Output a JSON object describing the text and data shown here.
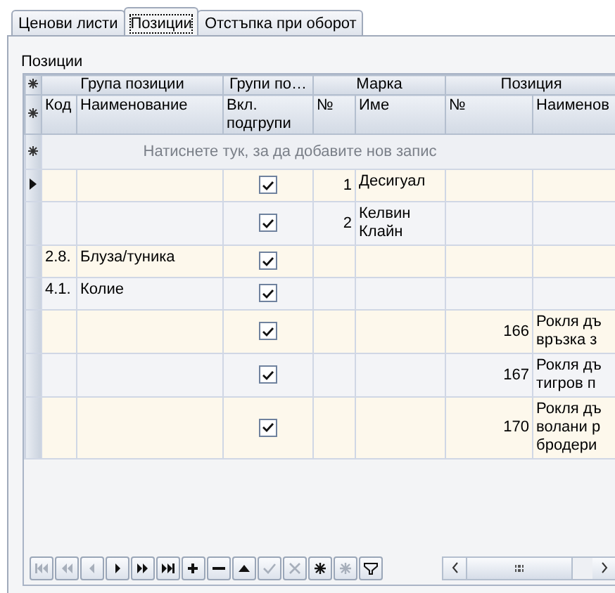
{
  "tabs": [
    {
      "label": "Ценови листи",
      "selected": false
    },
    {
      "label": "Позиции",
      "selected": true
    },
    {
      "label": "Отстъпка при оборот",
      "selected": false
    }
  ],
  "section_label": "Позиции",
  "grid": {
    "bands": [
      {
        "label": "Група позиции"
      },
      {
        "label": "Групи по…"
      },
      {
        "label": "Марка"
      },
      {
        "label": "Позиция"
      }
    ],
    "columns": [
      {
        "label": "Код",
        "kind": "text"
      },
      {
        "label": "Наименование",
        "kind": "text"
      },
      {
        "label": "Вкл. подгрупи",
        "kind": "check"
      },
      {
        "label": "№",
        "kind": "number"
      },
      {
        "label": "Име",
        "kind": "text"
      },
      {
        "label": "№",
        "kind": "number"
      },
      {
        "label": "Наименов",
        "kind": "text"
      }
    ],
    "new_row_prompt": "Натиснете тук, за да добавите нов запис",
    "rows": [
      {
        "selected": true,
        "include_subgroups": true,
        "brand_no": "1",
        "brand_name": "Десигуал"
      },
      {
        "selected": false,
        "include_subgroups": true,
        "brand_no": "2",
        "brand_name": "Келвин Клайн"
      },
      {
        "selected": false,
        "code": "2.8.",
        "name": "Блуза/туника",
        "include_subgroups": true
      },
      {
        "selected": false,
        "code": "4.1.",
        "name": "Колие",
        "include_subgroups": true
      },
      {
        "selected": false,
        "include_subgroups": true,
        "item_no": "166",
        "item_name": [
          "Рокля дъ",
          "връзка з"
        ]
      },
      {
        "selected": false,
        "include_subgroups": true,
        "item_no": "167",
        "item_name": [
          "Рокля дъ",
          "тигров п"
        ]
      },
      {
        "selected": false,
        "include_subgroups": true,
        "item_no": "170",
        "item_name": [
          "Рокля дъ",
          "волани р",
          "бродери"
        ]
      }
    ]
  },
  "navigator": {
    "buttons": [
      {
        "kind": "first",
        "disabled": true
      },
      {
        "kind": "prev-page",
        "disabled": true
      },
      {
        "kind": "prev",
        "disabled": true
      },
      {
        "kind": "next",
        "disabled": false
      },
      {
        "kind": "next-page",
        "disabled": false
      },
      {
        "kind": "last",
        "disabled": false
      },
      {
        "kind": "insert",
        "disabled": false
      },
      {
        "kind": "delete",
        "disabled": false
      },
      {
        "kind": "edit",
        "disabled": false
      },
      {
        "kind": "post",
        "disabled": true
      },
      {
        "kind": "cancel",
        "disabled": true
      },
      {
        "kind": "refresh",
        "disabled": false
      },
      {
        "kind": "bookmark",
        "disabled": true
      },
      {
        "kind": "filter",
        "disabled": false
      }
    ]
  }
}
